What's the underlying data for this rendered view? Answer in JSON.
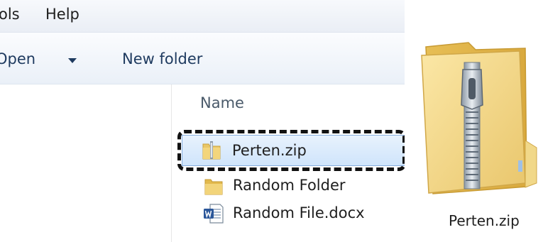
{
  "menu": {
    "tools_partial": "ols",
    "help": "Help"
  },
  "toolbar": {
    "open_partial": "Open",
    "new_folder": "New folder"
  },
  "columns": {
    "name": "Name"
  },
  "files": [
    {
      "name": "Perten.zip",
      "icon": "zip-folder-icon",
      "selected": true
    },
    {
      "name": "Random Folder",
      "icon": "folder-icon"
    },
    {
      "name": "Random File.docx",
      "icon": "word-document-icon"
    }
  ],
  "preview": {
    "label": "Perten.zip",
    "icon": "large-zip-folder-icon"
  },
  "colors": {
    "selection": "#cfe4fb",
    "folder": "#e8c867",
    "word": "#2b579a"
  }
}
